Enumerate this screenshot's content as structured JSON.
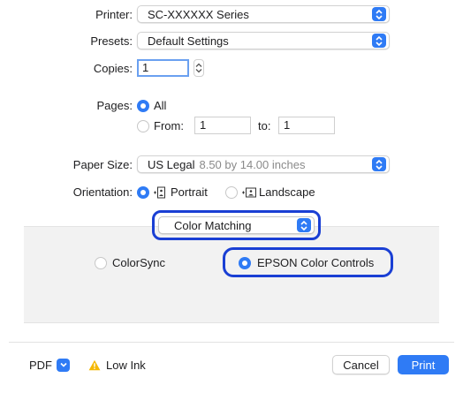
{
  "printer": {
    "label": "Printer:",
    "value": "SC-XXXXXX Series"
  },
  "presets": {
    "label": "Presets:",
    "value": "Default Settings"
  },
  "copies": {
    "label": "Copies:",
    "value": "1"
  },
  "pages": {
    "label": "Pages:",
    "all_label": "All",
    "from_label": "From:",
    "from_value": "1",
    "to_label": "to:",
    "to_value": "1",
    "selected": "all"
  },
  "paper_size": {
    "label": "Paper Size:",
    "name": "US Legal",
    "dimensions": "8.50 by 14.00 inches"
  },
  "orientation": {
    "label": "Orientation:",
    "portrait_label": "Portrait",
    "landscape_label": "Landscape",
    "selected": "portrait"
  },
  "section_popup": {
    "value": "Color Matching"
  },
  "color_matching": {
    "colorsync_label": "ColorSync",
    "epson_label": "EPSON Color Controls",
    "selected": "epson"
  },
  "footer": {
    "pdf_label": "PDF",
    "warning_label": "Low Ink",
    "cancel_label": "Cancel",
    "print_label": "Print"
  },
  "colors": {
    "accent": "#2f7bf5",
    "highlight": "#1a3fd4",
    "warning": "#f5b800"
  }
}
